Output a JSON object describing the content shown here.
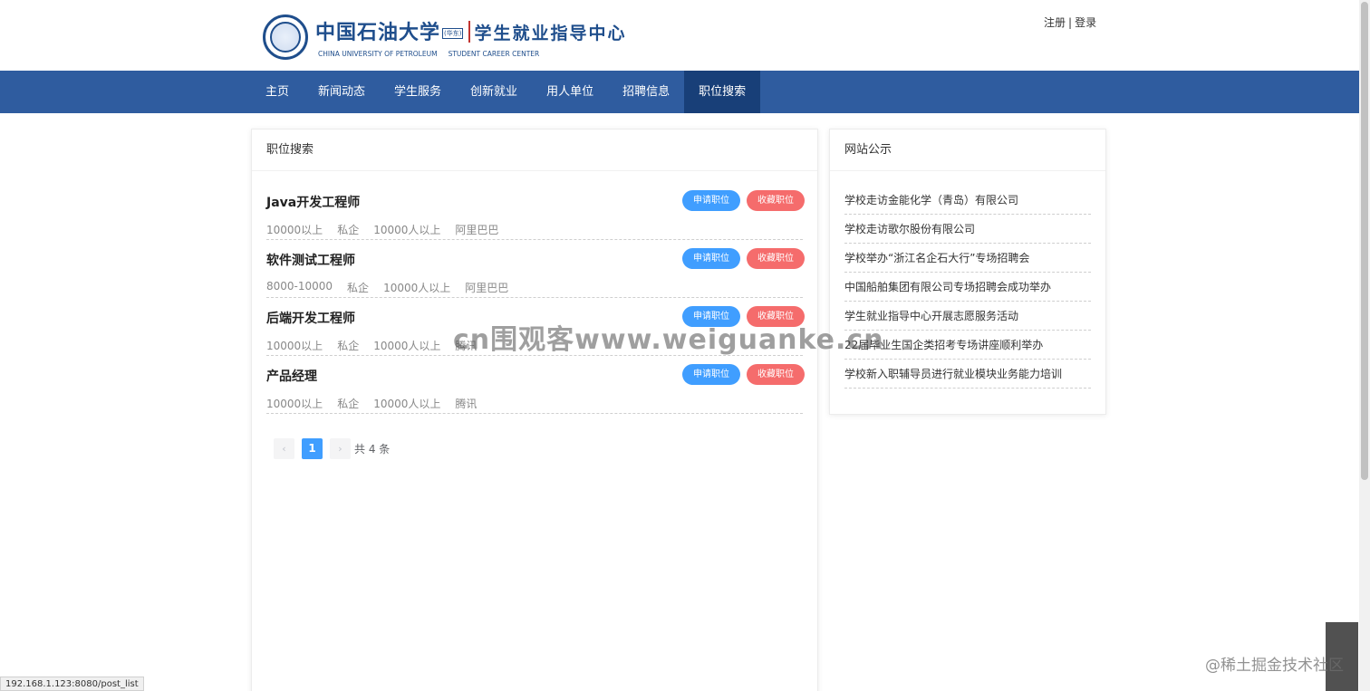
{
  "header": {
    "logo_cn": "中国石油大学",
    "logo_tag": "(华东)",
    "logo_center": "学生就业指导中心",
    "logo_en_left": "CHINA UNIVERSITY OF PETROLEUM",
    "logo_en_right": "STUDENT CAREER CENTER",
    "register": "注册",
    "sep": "|",
    "login": "登录"
  },
  "nav": {
    "items": [
      {
        "label": "主页"
      },
      {
        "label": "新闻动态"
      },
      {
        "label": "学生服务"
      },
      {
        "label": "创新就业"
      },
      {
        "label": "用人单位"
      },
      {
        "label": "招聘信息"
      },
      {
        "label": "职位搜索",
        "active": true
      }
    ]
  },
  "jobs": {
    "title": "职位搜索",
    "apply_label": "申请职位",
    "fav_label": "收藏职位",
    "items": [
      {
        "name": "Java开发工程师",
        "salary": "10000以上",
        "type": "私企",
        "size": "10000人以上",
        "company": "阿里巴巴"
      },
      {
        "name": "软件测试工程师",
        "salary": "8000-10000",
        "type": "私企",
        "size": "10000人以上",
        "company": "阿里巴巴"
      },
      {
        "name": "后端开发工程师",
        "salary": "10000以上",
        "type": "私企",
        "size": "10000人以上",
        "company": "腾讯"
      },
      {
        "name": "产品经理",
        "salary": "10000以上",
        "type": "私企",
        "size": "10000人以上",
        "company": "腾讯"
      }
    ],
    "pagination": {
      "prev": "‹",
      "current": "1",
      "next": "›",
      "total": "共 4 条"
    }
  },
  "notices": {
    "title": "网站公示",
    "items": [
      "学校走访金能化学（青岛）有限公司",
      "学校走访歌尔股份有限公司",
      "学校举办“浙江名企石大行”专场招聘会",
      "中国船舶集团有限公司专场招聘会成功举办",
      "学生就业指导中心开展志愿服务活动",
      "22届毕业生国企类招考专场讲座顺利举办",
      "学校新入职辅导员进行就业模块业务能力培训"
    ]
  },
  "status_bar": "192.168.1.123:8080/post_list",
  "watermarks": {
    "center": "cn围观客www.weiguanke.cn",
    "corner": "@稀土掘金技术社区"
  },
  "colors": {
    "nav_bg": "#2f5c9f",
    "nav_active": "#183f78",
    "brand": "#1f4e8c",
    "apply_btn": "#409eff",
    "fav_btn": "#f56c6c"
  }
}
